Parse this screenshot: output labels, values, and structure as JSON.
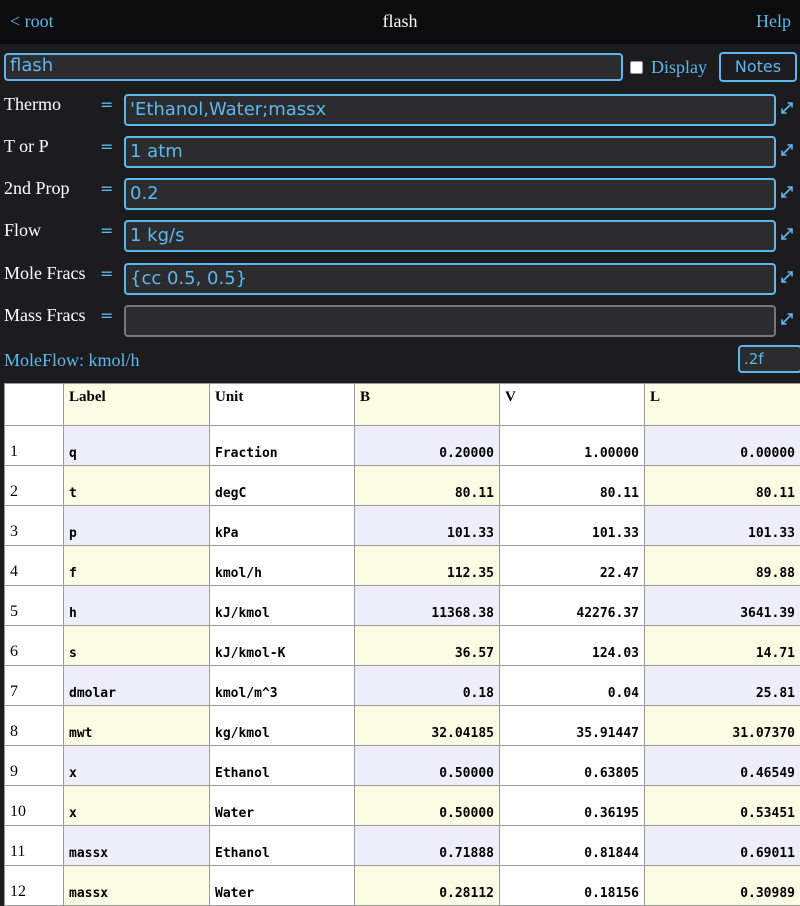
{
  "topbar": {
    "back": "< root",
    "title": "flash",
    "help": "Help"
  },
  "block": {
    "name": "flash",
    "display_label": "Display",
    "notes_label": "Notes"
  },
  "fields": [
    {
      "label": "Thermo",
      "eq": "=",
      "value": "'Ethanol,Water;massx"
    },
    {
      "label": "T or P",
      "eq": "=",
      "value": "1 atm"
    },
    {
      "label": "2nd Prop",
      "eq": "=",
      "value": "0.2"
    },
    {
      "label": "Flow",
      "eq": "=",
      "value": "1 kg/s"
    },
    {
      "label": "Mole Fracs",
      "eq": "=",
      "value": "{cc 0.5, 0.5}"
    },
    {
      "label": "Mass Fracs",
      "eq": "=",
      "value": ""
    }
  ],
  "moleflow": "MoleFlow: kmol/h",
  "format": ".2f",
  "table": {
    "headers": [
      "",
      "Label",
      "Unit",
      "B",
      "V",
      "L"
    ],
    "rows": [
      [
        "1",
        "q",
        "Fraction",
        "0.20000",
        "1.00000",
        "0.00000"
      ],
      [
        "2",
        "t",
        "degC",
        "80.11",
        "80.11",
        "80.11"
      ],
      [
        "3",
        "p",
        "kPa",
        "101.33",
        "101.33",
        "101.33"
      ],
      [
        "4",
        "f",
        "kmol/h",
        "112.35",
        "22.47",
        "89.88"
      ],
      [
        "5",
        "h",
        "kJ/kmol",
        "11368.38",
        "42276.37",
        "3641.39"
      ],
      [
        "6",
        "s",
        "kJ/kmol-K",
        "36.57",
        "124.03",
        "14.71"
      ],
      [
        "7",
        "dmolar",
        "kmol/m^3",
        "0.18",
        "0.04",
        "25.81"
      ],
      [
        "8",
        "mwt",
        "kg/kmol",
        "32.04185",
        "35.91447",
        "31.07370"
      ],
      [
        "9",
        "x",
        "Ethanol",
        "0.50000",
        "0.63805",
        "0.46549"
      ],
      [
        "10",
        "x",
        "Water",
        "0.50000",
        "0.36195",
        "0.53451"
      ],
      [
        "11",
        "massx",
        "Ethanol",
        "0.71888",
        "0.81844",
        "0.69011"
      ],
      [
        "12",
        "massx",
        "Water",
        "0.28112",
        "0.18156",
        "0.30989"
      ]
    ]
  },
  "colors": {
    "accent": "#5cb8ee",
    "header_yellow": "#fcfbe3",
    "row_blue": "#eeeefb"
  }
}
